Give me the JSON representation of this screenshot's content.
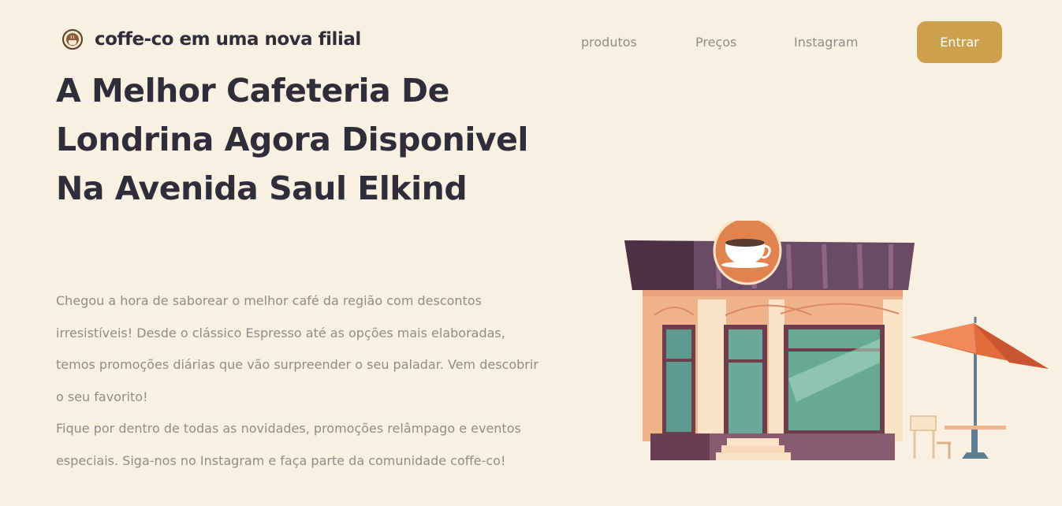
{
  "header": {
    "brand": "coffe-co em uma nova filial",
    "logo_icon": "coffee-logo-icon",
    "nav": [
      {
        "label": "produtos"
      },
      {
        "label": "Preços"
      },
      {
        "label": "Instagram"
      }
    ],
    "cta_label": "Entrar"
  },
  "hero": {
    "title": "A Melhor Cafeteria De Londrina Agora Disponivel Na Avenida Saul Elkind",
    "paragraph1": "Chegou a hora de saborear o melhor café da região com descontos irresistíveis! Desde o clássico Espresso até as opções mais elaboradas, temos promoções diárias que vão surpreender o seu paladar. Vem descobrir o seu favorito!",
    "paragraph2": "Fique por dentro de todas as novidades, promoções relâmpago e eventos especiais. Siga-nos no Instagram e faça parte da comunidade coffe-co!"
  },
  "illustration": {
    "icon": "coffee-shop-illustration",
    "sign_icon": "coffee-cup-icon"
  },
  "colors": {
    "background": "#f9f0e1",
    "accent": "#cda04d",
    "heading": "#2f2d3a",
    "text": "#8f8b87"
  }
}
